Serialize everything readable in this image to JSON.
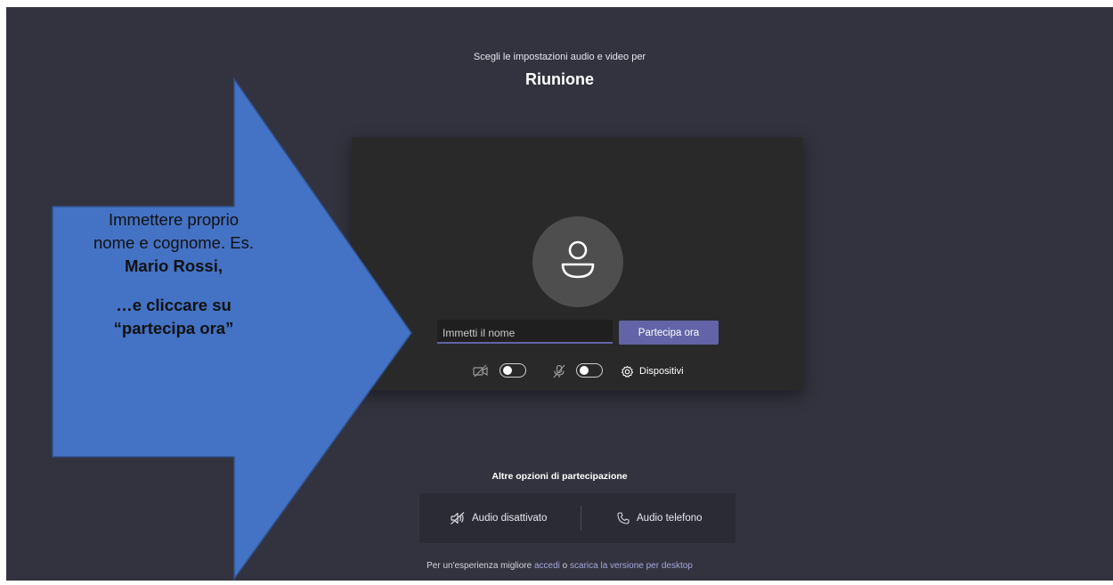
{
  "meeting": {
    "subtitle": "Scegli le impostazioni audio e video per",
    "title": "Riunione"
  },
  "prejoin": {
    "name_placeholder": "Immetti il nome",
    "join_label": "Partecipa ora",
    "devices_label": "Dispositivi",
    "camera_icon": "camera-off-icon",
    "mic_icon": "mic-off-icon",
    "devices_icon": "gear-icon",
    "avatar_icon": "person-icon",
    "camera_on": false,
    "mic_on": false
  },
  "other_options": {
    "title": "Altre opzioni di partecipazione",
    "audio_off_label": "Audio disattivato",
    "audio_phone_label": "Audio telefono"
  },
  "footer": {
    "prefix": "Per un'esperienza migliore",
    "signin_link": "accedi",
    "middle": "o",
    "download_link": "scarica la versione per desktop"
  },
  "callout": {
    "line1": "Immettere proprio",
    "line2": "nome e cognome. Es.",
    "line3": "Mario Rossi,",
    "line4": "…e cliccare su",
    "line5": "“partecipa ora”"
  },
  "colors": {
    "background": "#33333f",
    "card": "#292929",
    "accent": "#6264a7",
    "callout_fill": "#4472c4",
    "link": "#a6a7dc"
  }
}
